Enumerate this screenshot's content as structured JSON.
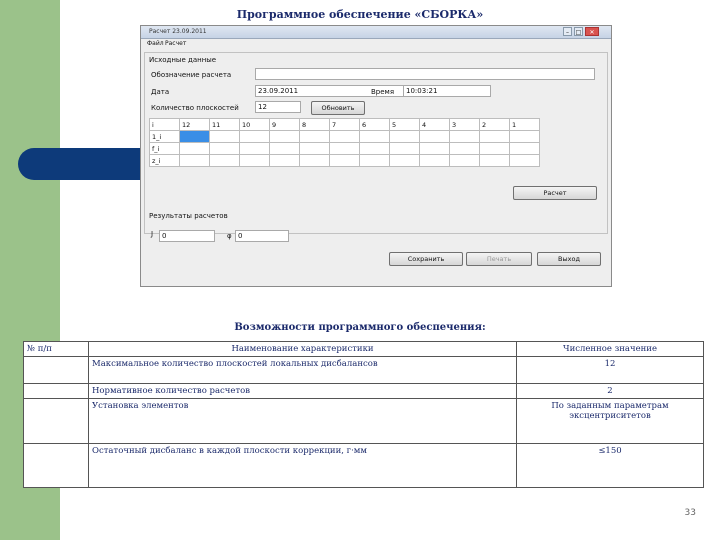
{
  "slide": {
    "title": "Программное обеспечение «СБОРКА»",
    "subtitle": "Возможности программного обеспечения:",
    "page_number": "33",
    "colors": {
      "side_bar": "#9bc28a",
      "accent_pill": "#0d3a7a",
      "title_text": "#1b2a6b"
    }
  },
  "window": {
    "title": "Расчет 23.09.2011",
    "menu": [
      "Файл",
      "Расчет"
    ],
    "input_group": {
      "label": "Исходные данные",
      "designation_label": "Обозначение расчета",
      "designation_value": "",
      "date_label": "Дата",
      "date_value": "23.09.2011",
      "calendar_icon": "calendar-icon",
      "time_label": "Время",
      "time_value": "10:03:21",
      "planes_label": "Количество плоскостей",
      "planes_value": "12",
      "refresh_button": "Обновить"
    },
    "grid": {
      "headers": [
        "i",
        "12",
        "11",
        "10",
        "9",
        "8",
        "7",
        "6",
        "5",
        "4",
        "3",
        "2",
        "1"
      ],
      "rows": [
        "1_i",
        "f_i",
        "z_i"
      ],
      "selected_cell": "1_i / 12"
    },
    "calc_button": "Расчет",
    "results": {
      "label": "Результаты расчетов",
      "j_label": "J",
      "j_value": "0",
      "phi_label": "φ",
      "phi_value": "0"
    },
    "buttons": {
      "save": "Сохранить",
      "print": "Печать",
      "exit": "Выход"
    }
  },
  "spec_table": {
    "headers": [
      "№ п/п",
      "Наименование характеристики",
      "Численное значение"
    ],
    "rows": [
      {
        "num": "",
        "name": "Максимальное количество плоскостей локальных дисбалансов",
        "value": "12"
      },
      {
        "num": "",
        "name": "Нормативное количество расчетов",
        "value": "2"
      },
      {
        "num": "",
        "name": "Установка элементов",
        "value": "По заданным параметрам эксцентриситетов"
      },
      {
        "num": "",
        "name": "Остаточный дисбаланс в каждой плоскости коррекции, г·мм",
        "value": "≤150"
      }
    ]
  }
}
